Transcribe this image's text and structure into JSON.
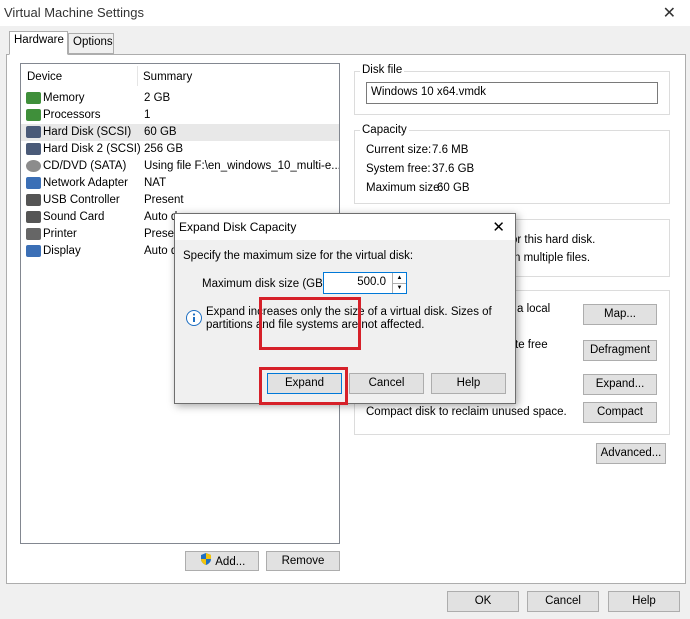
{
  "window": {
    "title": "Virtual Machine Settings",
    "close_glyph": "✕"
  },
  "tabs": [
    {
      "label": "Hardware"
    },
    {
      "label": "Options"
    }
  ],
  "device_list": {
    "headers": {
      "device": "Device",
      "summary": "Summary"
    },
    "rows": [
      {
        "device": "Memory",
        "summary": "2 GB",
        "icon": "memory-icon"
      },
      {
        "device": "Processors",
        "summary": "1",
        "icon": "processor-icon"
      },
      {
        "device": "Hard Disk (SCSI)",
        "summary": "60 GB",
        "icon": "hard-disk-icon",
        "selected": true
      },
      {
        "device": "Hard Disk 2 (SCSI)",
        "summary": "256 GB",
        "icon": "hard-disk-icon"
      },
      {
        "device": "CD/DVD (SATA)",
        "summary": "Using file F:\\en_windows_10_multi-e...",
        "icon": "cd-dvd-icon"
      },
      {
        "device": "Network Adapter",
        "summary": "NAT",
        "icon": "network-adapter-icon"
      },
      {
        "device": "USB Controller",
        "summary": "Present",
        "icon": "usb-controller-icon"
      },
      {
        "device": "Sound Card",
        "summary": "Auto d",
        "icon": "sound-card-icon"
      },
      {
        "device": "Printer",
        "summary": "Presen",
        "icon": "printer-icon"
      },
      {
        "device": "Display",
        "summary": "Auto d",
        "icon": "display-icon"
      }
    ]
  },
  "list_buttons": {
    "add": "Add...",
    "remove": "Remove"
  },
  "disk_file": {
    "label": "Disk file",
    "value": "Windows 10 x64.vmdk"
  },
  "capacity": {
    "label": "Capacity",
    "current_size": "Current size:",
    "current_size_value": "7.6 MB",
    "system_free": "System free:",
    "system_free_value": "37.6 GB",
    "maximum_size": "Maximum size:",
    "maximum_size_value": "60 GB"
  },
  "disk_info": {
    "line1": "or this hard disk.",
    "line2": "n multiple files."
  },
  "utilities": {
    "map_text": "a local",
    "defrag_text": "te free",
    "map": "Map...",
    "defragment": "Defragment",
    "expand": "Expand...",
    "compact_text": "Compact disk to reclaim unused space.",
    "compact": "Compact"
  },
  "advanced": "Advanced...",
  "footer": {
    "ok": "OK",
    "cancel": "Cancel",
    "help": "Help"
  },
  "dialog": {
    "title": "Expand Disk Capacity",
    "close_glyph": "✕",
    "prompt": "Specify the maximum size for the virtual disk:",
    "size_label": "Maximum disk size (GB):",
    "size_value": "500.0",
    "info_line1": "Expand increases only the size of a virtual disk. Sizes of",
    "info_line2": "partitions and file systems are not affected.",
    "expand": "Expand",
    "cancel": "Cancel",
    "help": "Help"
  },
  "colors": {
    "highlight": "#d62029",
    "selection": "#e8e8e8",
    "info": "#1e6fc2"
  }
}
